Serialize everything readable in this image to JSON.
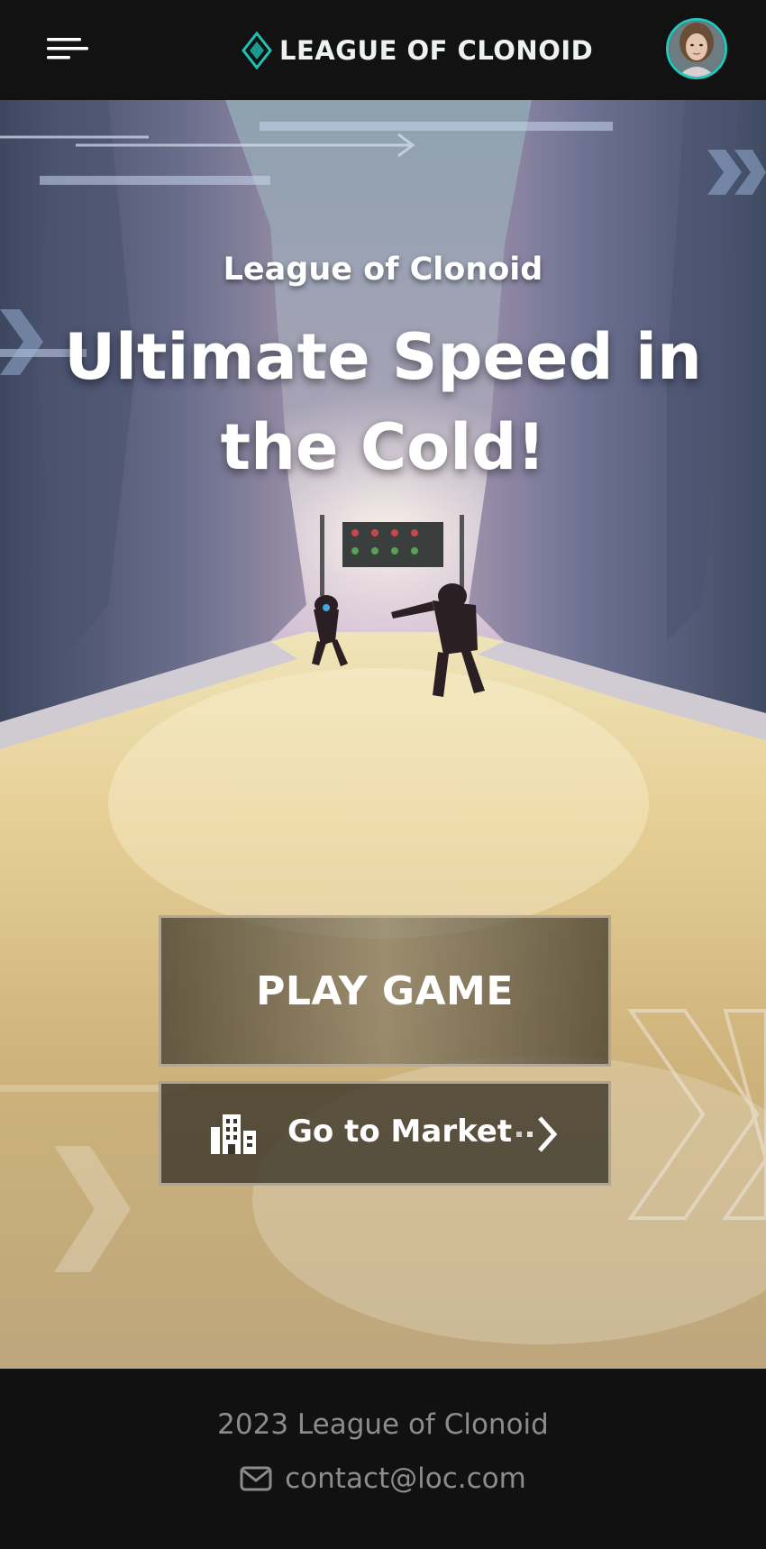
{
  "header": {
    "logo_text": "LEAGUE OF CLONOID",
    "menu_icon": "hamburger-menu-icon",
    "logo_icon": "diamond-logo-icon",
    "avatar": "user-avatar"
  },
  "hero": {
    "subtitle": "League of Clonoid",
    "title": "Ultimate Speed in the Cold!",
    "play_button_label": "PLAY GAME",
    "market_button_label": "Go to Market",
    "market_icon": "building-icon",
    "market_arrow_icon": "arrow-right-icon"
  },
  "footer": {
    "copyright": "2023 League of Clonoid",
    "email": "contact@loc.com",
    "email_icon": "mail-icon"
  },
  "colors": {
    "accent": "#20c9bb",
    "header_bg": "#121212",
    "footer_text": "#8c8c8c"
  }
}
